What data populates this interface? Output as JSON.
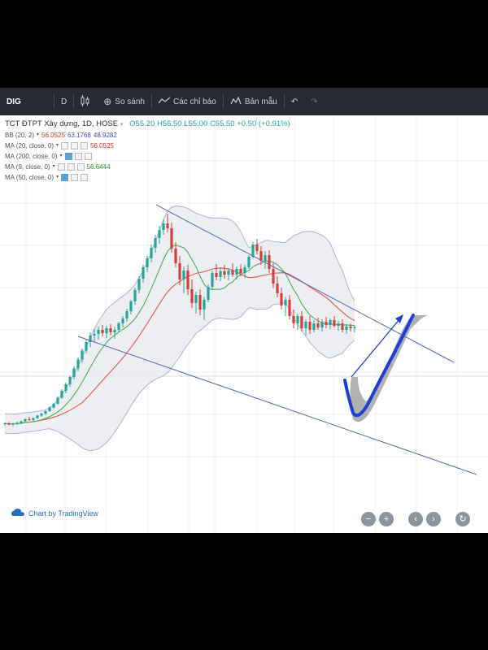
{
  "toolbar": {
    "symbol": "DIG",
    "interval": "D",
    "compare_label": "So sánh",
    "indicators_label": "Các chỉ báo",
    "template_label": "Bản mẫu"
  },
  "legend": {
    "title": "TCT ĐTPT Xây dựng, 1D, HOSE",
    "ohlc": {
      "o": "O55.20",
      "h": "H56.50",
      "l": "L55.00",
      "c": "C55.50",
      "chg": "+0.50 (+0.91%)"
    },
    "indicators": [
      {
        "name": "BB (20, 2)",
        "values": [
          "56.0525",
          "63.1768",
          "48.9282"
        ]
      },
      {
        "name": "MA (20, close, 0)",
        "values": [
          "56.0525"
        ]
      },
      {
        "name": "MA (200, close, 0)",
        "values": []
      },
      {
        "name": "MA (9, close, 0)",
        "values": [
          "56.6444"
        ]
      },
      {
        "name": "MA (50, close, 0)",
        "values": []
      }
    ]
  },
  "watermark": "Chart by TradingView",
  "colors": {
    "up": "#26a69a",
    "down": "#d43f3a",
    "ma20": "#e0584a",
    "ma9": "#4caf50",
    "bb_fill": "#e6e8ee",
    "bb_line": "#aeb4cc",
    "trendline": "#5a64b8",
    "drawing_blue": "#1e3fd6",
    "drawing_shadow": "#7d7d7d"
  },
  "chart_data": {
    "type": "candlestick",
    "bars": [
      [
        22,
        22.4,
        21.6,
        22.2
      ],
      [
        22.2,
        22.5,
        21.7,
        21.9
      ],
      [
        21.9,
        22.3,
        21.5,
        22.1
      ],
      [
        22.1,
        22.6,
        21.8,
        22.3
      ],
      [
        22.3,
        22.9,
        22.0,
        22.7
      ],
      [
        22.7,
        23.4,
        22.4,
        23.2
      ],
      [
        23.2,
        23.8,
        22.8,
        23.0
      ],
      [
        23.0,
        23.6,
        22.7,
        23.5
      ],
      [
        23.5,
        24.3,
        23.2,
        24.1
      ],
      [
        24.1,
        24.8,
        23.8,
        24.6
      ],
      [
        24.6,
        25.4,
        24.2,
        25.2
      ],
      [
        25.2,
        26.4,
        25.0,
        26.1
      ],
      [
        26.1,
        27.2,
        25.8,
        27.0
      ],
      [
        27.0,
        28.8,
        26.8,
        28.5
      ],
      [
        28.5,
        30.6,
        28.2,
        30.2
      ],
      [
        30.2,
        32.2,
        29.6,
        31.8
      ],
      [
        31.8,
        34.0,
        31.2,
        33.6
      ],
      [
        33.6,
        36.2,
        33.0,
        35.7
      ],
      [
        35.7,
        38.4,
        35.0,
        37.9
      ],
      [
        37.9,
        40.6,
        37.2,
        40.1
      ],
      [
        40.1,
        42.8,
        39.4,
        42.2
      ],
      [
        42.2,
        44.6,
        41.0,
        43.8
      ],
      [
        43.8,
        45.4,
        42.2,
        44.2
      ],
      [
        44.2,
        46.0,
        42.8,
        45.2
      ],
      [
        45.2,
        46.4,
        43.6,
        44.4
      ],
      [
        44.4,
        46.2,
        43.2,
        45.6
      ],
      [
        45.6,
        46.6,
        43.8,
        44.6
      ],
      [
        44.6,
        46.0,
        43.0,
        45.2
      ],
      [
        45.2,
        47.2,
        44.6,
        46.8
      ],
      [
        46.8,
        48.6,
        45.8,
        48.0
      ],
      [
        48.0,
        50.4,
        47.2,
        49.8
      ],
      [
        49.8,
        52.6,
        49.0,
        52.2
      ],
      [
        52.2,
        55.6,
        51.4,
        55.0
      ],
      [
        55.0,
        58.4,
        54.2,
        57.8
      ],
      [
        57.8,
        61.2,
        56.8,
        60.6
      ],
      [
        60.6,
        63.4,
        59.4,
        62.8
      ],
      [
        62.8,
        66.2,
        61.8,
        65.4
      ],
      [
        65.4,
        68.6,
        64.2,
        67.8
      ],
      [
        67.8,
        70.8,
        66.4,
        69.8
      ],
      [
        69.8,
        72.4,
        68.6,
        71.4
      ],
      [
        71.4,
        73.8,
        69.2,
        70.2
      ],
      [
        70.2,
        71.6,
        64.2,
        65.2
      ],
      [
        65.2,
        66.8,
        60.6,
        61.6
      ],
      [
        61.6,
        63.4,
        56.2,
        57.6
      ],
      [
        57.6,
        60.8,
        54.2,
        59.8
      ],
      [
        59.8,
        61.2,
        53.8,
        55.2
      ],
      [
        55.2,
        57.6,
        50.6,
        51.8
      ],
      [
        51.8,
        54.6,
        49.2,
        53.8
      ],
      [
        53.8,
        55.2,
        48.8,
        50.2
      ],
      [
        50.2,
        53.4,
        47.6,
        52.6
      ],
      [
        52.6,
        56.4,
        52.0,
        55.8
      ],
      [
        55.8,
        59.8,
        55.2,
        59.2
      ],
      [
        59.2,
        61.4,
        57.4,
        58.2
      ],
      [
        58.2,
        60.6,
        57.2,
        59.6
      ],
      [
        59.6,
        61.2,
        57.8,
        58.8
      ],
      [
        58.8,
        60.4,
        57.4,
        59.8
      ],
      [
        59.8,
        61.6,
        58.2,
        58.8
      ],
      [
        58.8,
        60.8,
        57.6,
        60.2
      ],
      [
        60.2,
        61.4,
        58.4,
        59.2
      ],
      [
        59.2,
        61.2,
        58.0,
        60.6
      ],
      [
        60.6,
        63.6,
        60.2,
        63.2
      ],
      [
        63.2,
        66.8,
        62.8,
        66.2
      ],
      [
        66.2,
        67.6,
        63.8,
        64.6
      ],
      [
        64.6,
        65.8,
        61.2,
        62.2
      ],
      [
        62.2,
        64.6,
        60.2,
        63.6
      ],
      [
        63.6,
        64.8,
        59.2,
        60.2
      ],
      [
        60.2,
        61.6,
        55.4,
        56.6
      ],
      [
        56.6,
        58.4,
        53.2,
        54.2
      ],
      [
        54.2,
        55.6,
        50.2,
        51.2
      ],
      [
        51.2,
        53.4,
        48.6,
        52.6
      ],
      [
        52.6,
        53.8,
        47.8,
        48.6
      ],
      [
        48.6,
        50.2,
        45.6,
        46.8
      ],
      [
        46.8,
        49.2,
        45.2,
        48.6
      ],
      [
        48.6,
        49.8,
        44.8,
        45.6
      ],
      [
        45.6,
        47.8,
        43.8,
        47.2
      ],
      [
        47.2,
        48.6,
        44.2,
        45.2
      ],
      [
        45.2,
        47.6,
        44.6,
        46.8
      ],
      [
        46.8,
        48.2,
        45.2,
        45.8
      ],
      [
        45.8,
        47.8,
        44.8,
        47.2
      ],
      [
        47.2,
        48.4,
        45.6,
        46.4
      ],
      [
        46.4,
        48.0,
        45.4,
        47.6
      ],
      [
        47.6,
        48.6,
        45.8,
        46.2
      ],
      [
        46.2,
        47.4,
        45.0,
        46.8
      ],
      [
        46.8,
        47.8,
        44.6,
        45.2
      ],
      [
        45.2,
        46.6,
        44.2,
        46.0
      ],
      [
        46.0,
        46.8,
        44.8,
        45.6
      ],
      [
        45.6,
        46.2,
        44.6,
        45.9
      ]
    ],
    "ylim": [
      14,
      76
    ],
    "grid": true,
    "legend_position": "top-left"
  }
}
